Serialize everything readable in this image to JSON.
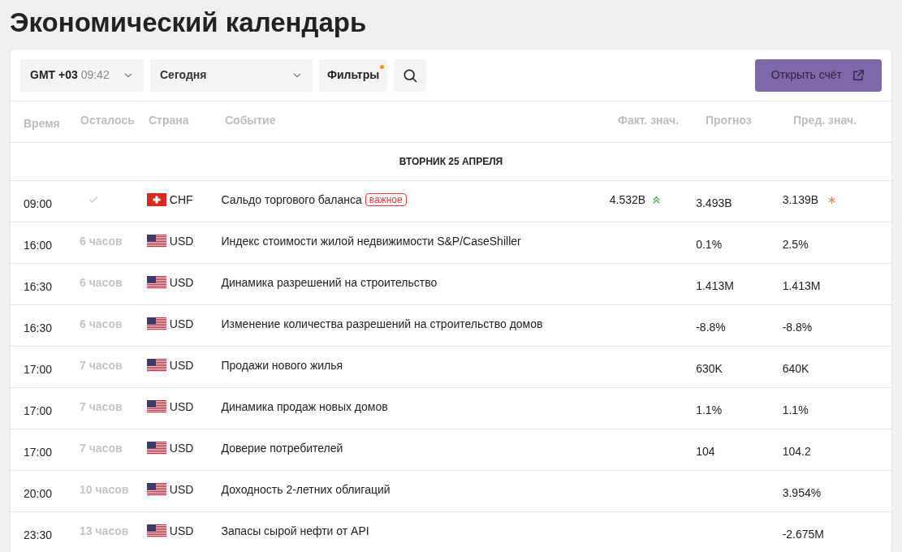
{
  "title": "Экономический календарь",
  "toolbar": {
    "timezone": "GMT +03",
    "clock": "09:42",
    "period": "Сегодня",
    "filters": {
      "label": "Фильтры",
      "active": true
    },
    "open_account": "Открыть счёт"
  },
  "table": {
    "columns": [
      "Время",
      "Осталось",
      "Страна",
      "Событие",
      "Факт. знач.",
      "Прогноз",
      "Пред. знач."
    ],
    "date": "ВТОРНИК 25 АПРЕЛЯ",
    "rows": [
      {
        "kind": "passed",
        "time": "09:00",
        "flag": {
          "kind": "ch"
        },
        "currency": "CHF",
        "event": "Сальдо торгового баланса",
        "badge": "важное",
        "actual": "4.532B",
        "rising": true,
        "forecast": "3.493B",
        "previous": "3.139B",
        "revised": true
      },
      {
        "kind": "upcoming",
        "time": "16:00",
        "remaining": "6 часов",
        "flag": {
          "kind": "us"
        },
        "currency": "USD",
        "event": "Индекс стоимости жилой недвижимости S&P/CaseShiller",
        "forecast": "0.1%",
        "previous": "2.5%",
        "revised": false
      },
      {
        "kind": "upcoming",
        "time": "16:30",
        "remaining": "6 часов",
        "flag": {
          "kind": "us"
        },
        "currency": "USD",
        "event": "Динамика разрешений на строительство",
        "forecast": "1.413M",
        "previous": "1.413M",
        "revised": false
      },
      {
        "kind": "upcoming",
        "time": "16:30",
        "remaining": "6 часов",
        "flag": {
          "kind": "us"
        },
        "currency": "USD",
        "event": "Изменение количества разрешений на строительство домов",
        "forecast": "-8.8%",
        "previous": "-8.8%",
        "revised": false
      },
      {
        "kind": "upcoming",
        "time": "17:00",
        "remaining": "7 часов",
        "flag": {
          "kind": "us"
        },
        "currency": "USD",
        "event": "Продажи нового жилья",
        "forecast": "630K",
        "previous": "640K",
        "revised": false
      },
      {
        "kind": "upcoming",
        "time": "17:00",
        "remaining": "7 часов",
        "flag": {
          "kind": "us"
        },
        "currency": "USD",
        "event": "Динамика продаж новых домов",
        "forecast": "1.1%",
        "previous": "1.1%",
        "revised": false
      },
      {
        "kind": "upcoming",
        "time": "17:00",
        "remaining": "7 часов",
        "flag": {
          "kind": "us"
        },
        "currency": "USD",
        "event": "Доверие потребителей",
        "forecast": "104",
        "previous": "104.2",
        "revised": false
      },
      {
        "kind": "upcoming",
        "time": "20:00",
        "remaining": "10 часов",
        "flag": {
          "kind": "us"
        },
        "currency": "USD",
        "event": "Доходность 2-летних облигаций",
        "previous": "3.954%",
        "revised": false
      },
      {
        "kind": "upcoming",
        "time": "23:30",
        "remaining": "13 часов",
        "flag": {
          "kind": "us"
        },
        "currency": "USD",
        "event": "Запасы сырой нефти от API",
        "previous": "-2.675M",
        "revised": false
      }
    ]
  }
}
